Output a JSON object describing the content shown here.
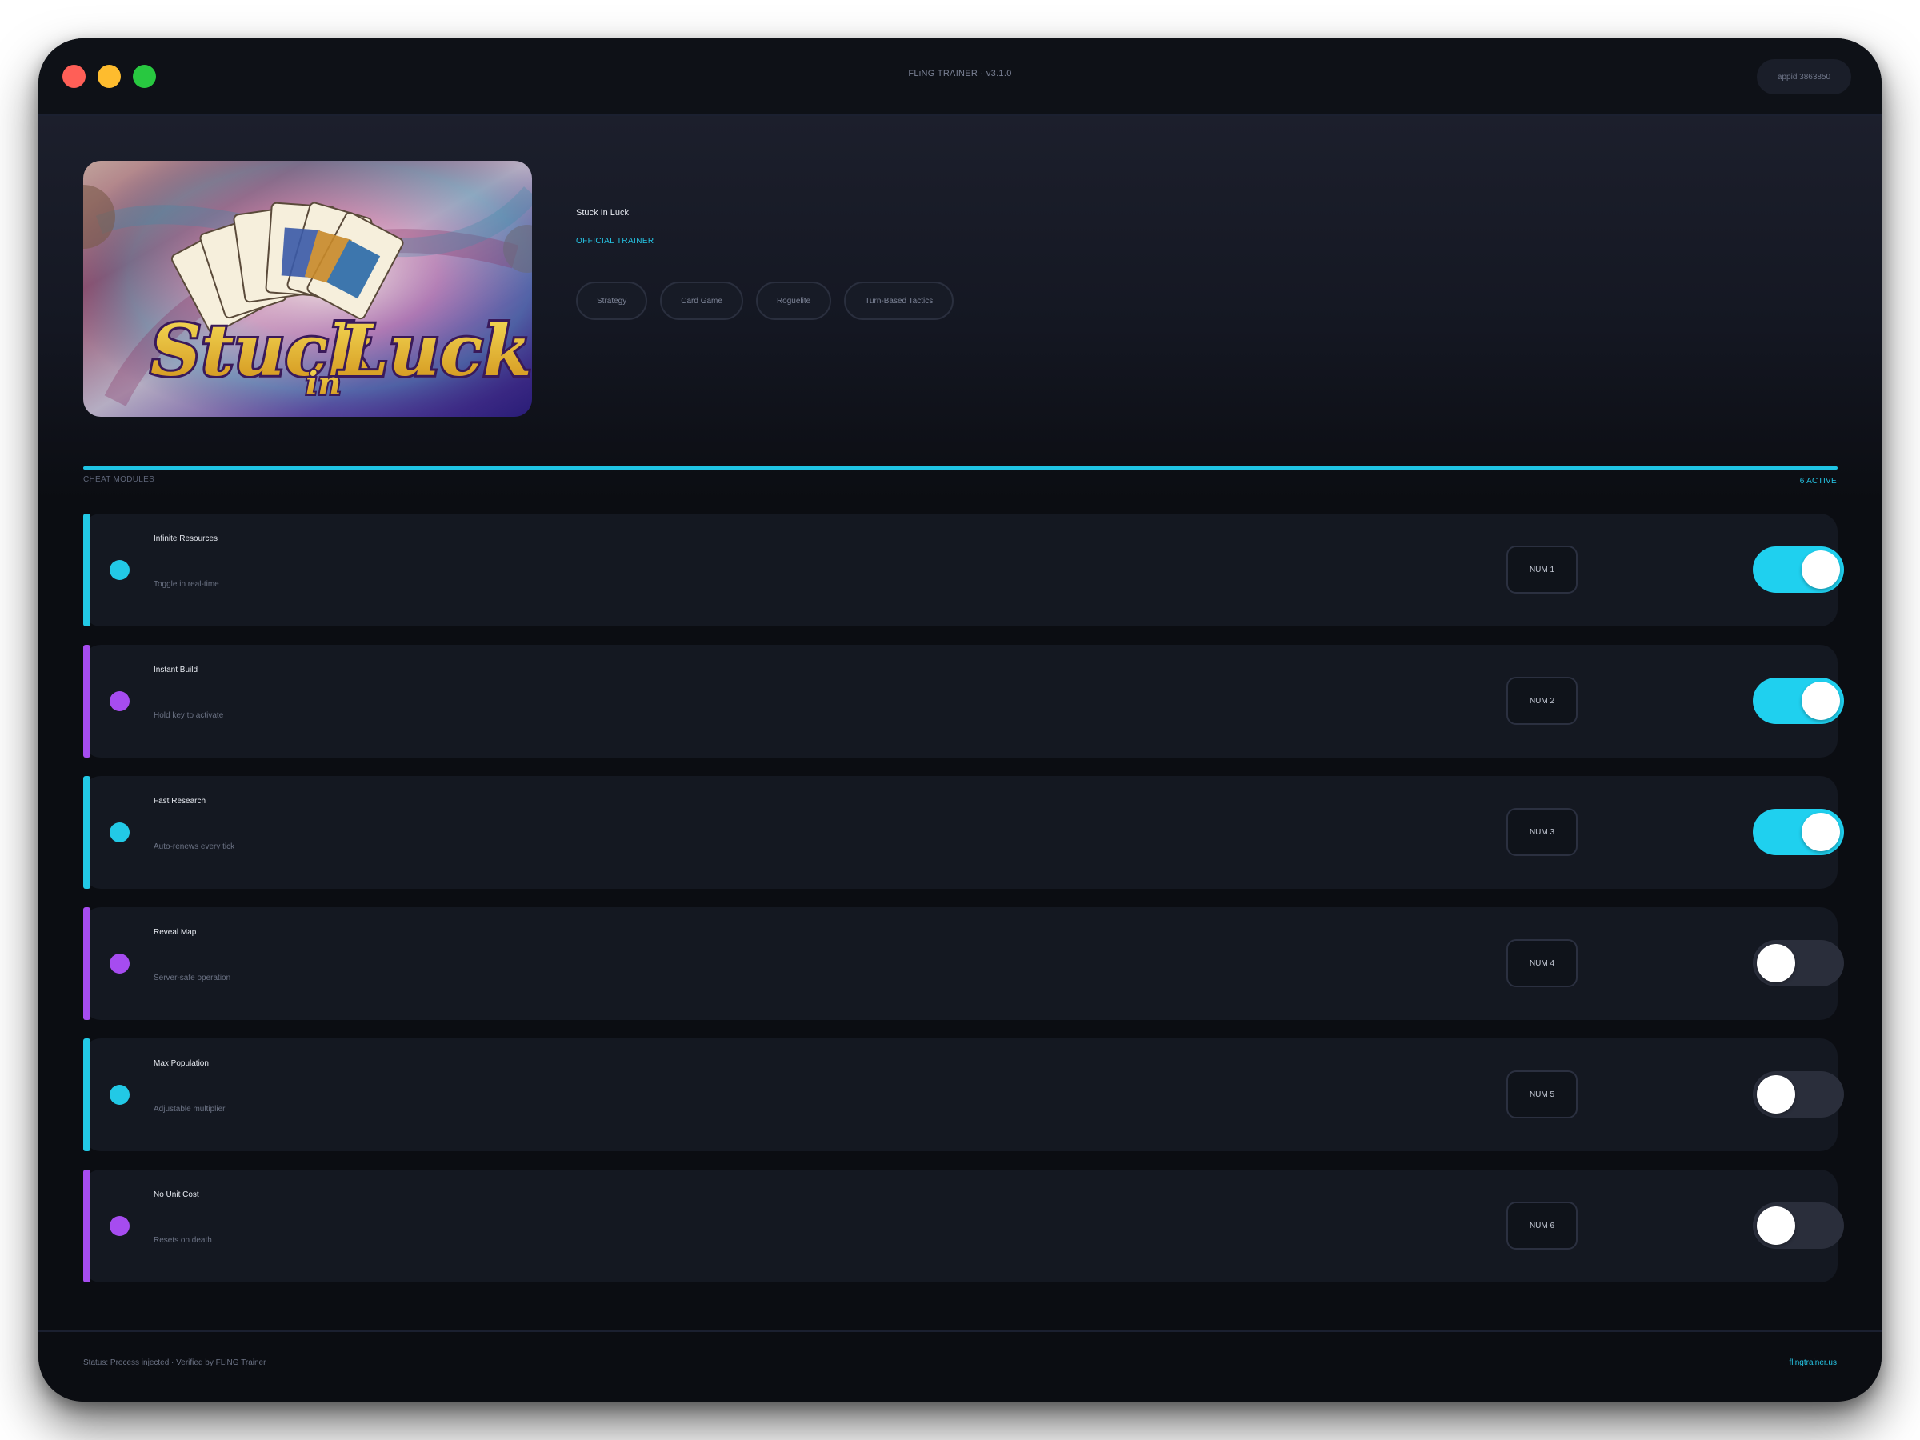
{
  "window": {
    "title": "FLiNG TRAINER · v3.1.0",
    "appid": "appid 3863850"
  },
  "game": {
    "title": "Stuck In Luck",
    "badge": "OFFICIAL TRAINER",
    "cover_logo": "Stuck in Luck",
    "tags": [
      "Strategy",
      "Card Game",
      "Roguelite",
      "Turn-Based Tactics"
    ]
  },
  "section": {
    "label": "CHEAT MODULES",
    "count": "6 ACTIVE"
  },
  "modules": [
    {
      "name": "Infinite Resources",
      "desc": "Toggle in real-time",
      "hotkey": "NUM 1",
      "enabled": true,
      "accent": "#22c9e6"
    },
    {
      "name": "Instant Build",
      "desc": "Hold key to activate",
      "hotkey": "NUM 2",
      "enabled": true,
      "accent": "#a64cf0"
    },
    {
      "name": "Fast Research",
      "desc": "Auto-renews every tick",
      "hotkey": "NUM 3",
      "enabled": true,
      "accent": "#22c9e6"
    },
    {
      "name": "Reveal Map",
      "desc": "Server-safe operation",
      "hotkey": "NUM 4",
      "enabled": false,
      "accent": "#a64cf0"
    },
    {
      "name": "Max Population",
      "desc": "Adjustable multiplier",
      "hotkey": "NUM 5",
      "enabled": false,
      "accent": "#22c9e6"
    },
    {
      "name": "No Unit Cost",
      "desc": "Resets on death",
      "hotkey": "NUM 6",
      "enabled": false,
      "accent": "#a64cf0"
    }
  ],
  "footer": {
    "status": "Status: Process injected · Verified by FLiNG Trainer",
    "link": "flingtrainer.us"
  },
  "colors": {
    "accent_cyan": "#1fd0ef",
    "accent_purple": "#a64cf0",
    "background": "#0b0d12"
  }
}
